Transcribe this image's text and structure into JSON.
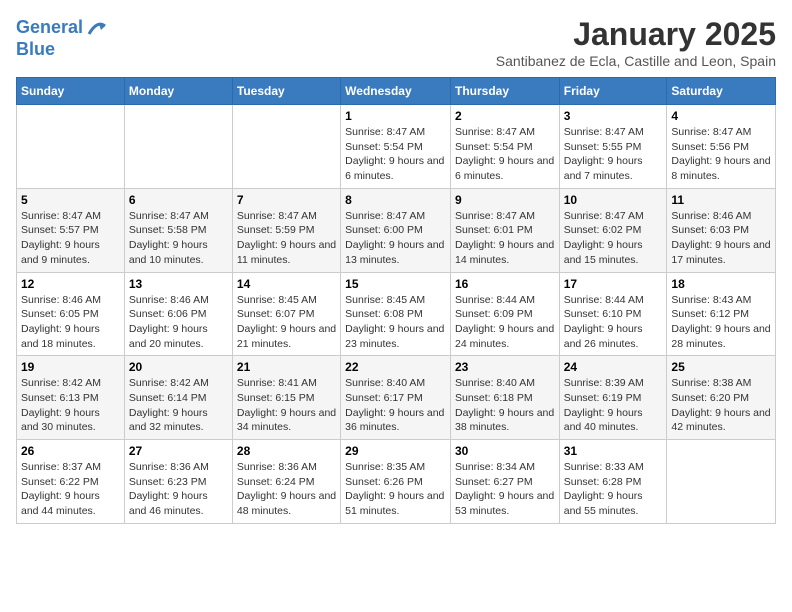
{
  "header": {
    "logo_line1": "General",
    "logo_line2": "Blue",
    "month_year": "January 2025",
    "location": "Santibanez de Ecla, Castille and Leon, Spain"
  },
  "weekdays": [
    "Sunday",
    "Monday",
    "Tuesday",
    "Wednesday",
    "Thursday",
    "Friday",
    "Saturday"
  ],
  "weeks": [
    [
      {
        "day": "",
        "info": ""
      },
      {
        "day": "",
        "info": ""
      },
      {
        "day": "",
        "info": ""
      },
      {
        "day": "1",
        "info": "Sunrise: 8:47 AM\nSunset: 5:54 PM\nDaylight: 9 hours and 6 minutes."
      },
      {
        "day": "2",
        "info": "Sunrise: 8:47 AM\nSunset: 5:54 PM\nDaylight: 9 hours and 6 minutes."
      },
      {
        "day": "3",
        "info": "Sunrise: 8:47 AM\nSunset: 5:55 PM\nDaylight: 9 hours and 7 minutes."
      },
      {
        "day": "4",
        "info": "Sunrise: 8:47 AM\nSunset: 5:56 PM\nDaylight: 9 hours and 8 minutes."
      }
    ],
    [
      {
        "day": "5",
        "info": "Sunrise: 8:47 AM\nSunset: 5:57 PM\nDaylight: 9 hours and 9 minutes."
      },
      {
        "day": "6",
        "info": "Sunrise: 8:47 AM\nSunset: 5:58 PM\nDaylight: 9 hours and 10 minutes."
      },
      {
        "day": "7",
        "info": "Sunrise: 8:47 AM\nSunset: 5:59 PM\nDaylight: 9 hours and 11 minutes."
      },
      {
        "day": "8",
        "info": "Sunrise: 8:47 AM\nSunset: 6:00 PM\nDaylight: 9 hours and 13 minutes."
      },
      {
        "day": "9",
        "info": "Sunrise: 8:47 AM\nSunset: 6:01 PM\nDaylight: 9 hours and 14 minutes."
      },
      {
        "day": "10",
        "info": "Sunrise: 8:47 AM\nSunset: 6:02 PM\nDaylight: 9 hours and 15 minutes."
      },
      {
        "day": "11",
        "info": "Sunrise: 8:46 AM\nSunset: 6:03 PM\nDaylight: 9 hours and 17 minutes."
      }
    ],
    [
      {
        "day": "12",
        "info": "Sunrise: 8:46 AM\nSunset: 6:05 PM\nDaylight: 9 hours and 18 minutes."
      },
      {
        "day": "13",
        "info": "Sunrise: 8:46 AM\nSunset: 6:06 PM\nDaylight: 9 hours and 20 minutes."
      },
      {
        "day": "14",
        "info": "Sunrise: 8:45 AM\nSunset: 6:07 PM\nDaylight: 9 hours and 21 minutes."
      },
      {
        "day": "15",
        "info": "Sunrise: 8:45 AM\nSunset: 6:08 PM\nDaylight: 9 hours and 23 minutes."
      },
      {
        "day": "16",
        "info": "Sunrise: 8:44 AM\nSunset: 6:09 PM\nDaylight: 9 hours and 24 minutes."
      },
      {
        "day": "17",
        "info": "Sunrise: 8:44 AM\nSunset: 6:10 PM\nDaylight: 9 hours and 26 minutes."
      },
      {
        "day": "18",
        "info": "Sunrise: 8:43 AM\nSunset: 6:12 PM\nDaylight: 9 hours and 28 minutes."
      }
    ],
    [
      {
        "day": "19",
        "info": "Sunrise: 8:42 AM\nSunset: 6:13 PM\nDaylight: 9 hours and 30 minutes."
      },
      {
        "day": "20",
        "info": "Sunrise: 8:42 AM\nSunset: 6:14 PM\nDaylight: 9 hours and 32 minutes."
      },
      {
        "day": "21",
        "info": "Sunrise: 8:41 AM\nSunset: 6:15 PM\nDaylight: 9 hours and 34 minutes."
      },
      {
        "day": "22",
        "info": "Sunrise: 8:40 AM\nSunset: 6:17 PM\nDaylight: 9 hours and 36 minutes."
      },
      {
        "day": "23",
        "info": "Sunrise: 8:40 AM\nSunset: 6:18 PM\nDaylight: 9 hours and 38 minutes."
      },
      {
        "day": "24",
        "info": "Sunrise: 8:39 AM\nSunset: 6:19 PM\nDaylight: 9 hours and 40 minutes."
      },
      {
        "day": "25",
        "info": "Sunrise: 8:38 AM\nSunset: 6:20 PM\nDaylight: 9 hours and 42 minutes."
      }
    ],
    [
      {
        "day": "26",
        "info": "Sunrise: 8:37 AM\nSunset: 6:22 PM\nDaylight: 9 hours and 44 minutes."
      },
      {
        "day": "27",
        "info": "Sunrise: 8:36 AM\nSunset: 6:23 PM\nDaylight: 9 hours and 46 minutes."
      },
      {
        "day": "28",
        "info": "Sunrise: 8:36 AM\nSunset: 6:24 PM\nDaylight: 9 hours and 48 minutes."
      },
      {
        "day": "29",
        "info": "Sunrise: 8:35 AM\nSunset: 6:26 PM\nDaylight: 9 hours and 51 minutes."
      },
      {
        "day": "30",
        "info": "Sunrise: 8:34 AM\nSunset: 6:27 PM\nDaylight: 9 hours and 53 minutes."
      },
      {
        "day": "31",
        "info": "Sunrise: 8:33 AM\nSunset: 6:28 PM\nDaylight: 9 hours and 55 minutes."
      },
      {
        "day": "",
        "info": ""
      }
    ]
  ]
}
